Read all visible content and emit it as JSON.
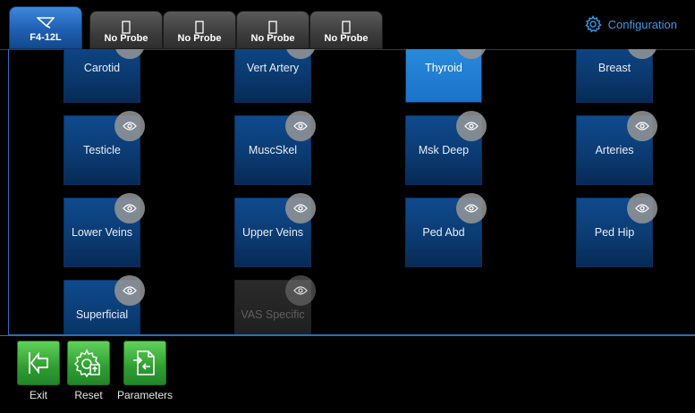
{
  "tabs": [
    {
      "label": "F4-12L",
      "active": true
    },
    {
      "label": "No Probe",
      "active": false
    },
    {
      "label": "No Probe",
      "active": false
    },
    {
      "label": "No Probe",
      "active": false
    },
    {
      "label": "No Probe",
      "active": false
    }
  ],
  "config": {
    "label": "Configuration",
    "icon": "gear-icon"
  },
  "presets": [
    {
      "label": "Carotid",
      "state": "normal"
    },
    {
      "label": "Vert Artery",
      "state": "normal"
    },
    {
      "label": "Thyroid",
      "state": "selected"
    },
    {
      "label": "Breast",
      "state": "normal"
    },
    {
      "label": "Testicle",
      "state": "normal"
    },
    {
      "label": "MuscSkel",
      "state": "normal"
    },
    {
      "label": "Msk Deep",
      "state": "normal"
    },
    {
      "label": "Arteries",
      "state": "normal"
    },
    {
      "label": "Lower Veins",
      "state": "normal"
    },
    {
      "label": "Upper Veins",
      "state": "normal"
    },
    {
      "label": "Ped Abd",
      "state": "normal"
    },
    {
      "label": "Ped Hip",
      "state": "normal"
    },
    {
      "label": "Superficial",
      "state": "normal"
    },
    {
      "label": "VAS Specific",
      "state": "disabled"
    }
  ],
  "toolbar": {
    "exit_label": "Exit",
    "reset_label": "Reset",
    "parameters_label": "Parameters"
  },
  "colors": {
    "accent": "#2a6fb8",
    "tile": "#0b3a70",
    "selected_tile": "#1a74c9",
    "tool_green": "#2f9e31"
  }
}
